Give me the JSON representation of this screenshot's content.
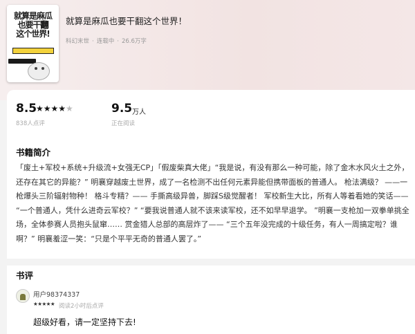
{
  "book": {
    "title": "就算是麻瓜也要干翻这个世界！",
    "meta": [
      "科幻末世",
      "·",
      "连载中",
      "·",
      "26.6万字"
    ],
    "cover": {
      "line1": "就算是麻瓜",
      "line2_prefix": "也要干",
      "line2_highlight": "翻",
      "line3": "这个世界!"
    }
  },
  "stats": {
    "score": "8.5",
    "stars": "★★★★",
    "half_star": "★",
    "rating_count": "838人点评",
    "readers": "9.5",
    "readers_unit": "万人",
    "readers_label": "正在阅读"
  },
  "intro": {
    "heading": "书籍简介",
    "text": "「废土+军校+系统+升级流+女强无CP」「假废柴真大佬」“我是说，有没有那么一种可能，除了金木水风火土之外，还存在其它的异能？” 明襄穿越废土世界，成了一名检测不出任何元素异能但携带面板的普通人。 枪法满级？ ——一枪爆头三阶辐射物种！ 格斗专精？—— 手撕高级异兽，脚踩S级觉醒者！ 军校新生大比，所有人等着看她的笑话—— “一个普通人，凭什么进奇云军校？” “要我说普通人就不该来读军校，还不如早早退学。 ”明襄一支枪加一双拳单挑全场，全体参赛人员抱头鼠窜…… 赏金猎人总部的高层炸了—— “三个五年没完成的十级任务，有人一周搞定啦？谁啊？” 明襄羞涩一笑：“只是个平平无奇的普通人罢了。”"
  },
  "reviews": {
    "heading": "书评",
    "items": [
      {
        "user": "用户98374337",
        "stars": "★★★★★",
        "time": "阅读2小时后点评",
        "text": "超级好看，请一定坚持下去!"
      }
    ]
  },
  "colors": {
    "header_bg": "#f2e3e2",
    "accent_yellow": "#f3d23c"
  }
}
